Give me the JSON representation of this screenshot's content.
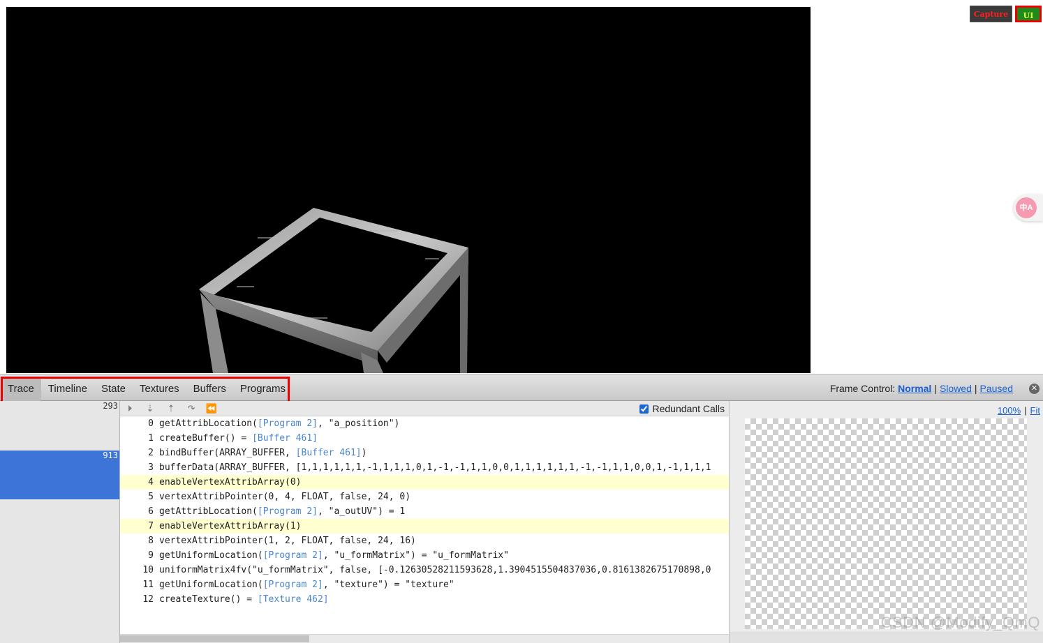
{
  "overlay": {
    "capture_label": "Capture",
    "ui_label": "UI",
    "translate_icon": "translate-icon",
    "translate_glyph": "中A"
  },
  "inspector": {
    "tabs": [
      "Trace",
      "Timeline",
      "State",
      "Textures",
      "Buffers",
      "Programs"
    ],
    "active_tab": "Trace",
    "frame_control": {
      "label": "Frame Control:",
      "options": [
        "Normal",
        "Slowed",
        "Paused"
      ],
      "selected": "Normal"
    },
    "close_icon": "close-icon"
  },
  "frames": [
    {
      "id": "293"
    },
    {
      "id": "913",
      "selected": true
    }
  ],
  "trace": {
    "step_icons": [
      "play-icon",
      "step-over-icon",
      "step-out-icon",
      "step-forward-icon",
      "rewind-icon"
    ],
    "step_glyphs": [
      "⏵",
      "⇣",
      "⇡",
      "↷",
      "⏪"
    ],
    "redundant_calls_label": "Redundant Calls",
    "redundant_calls_checked": true,
    "calls": [
      {
        "n": "0",
        "parts": [
          [
            "getAttribLocation(",
            ""
          ],
          [
            "[Program 2]",
            "ref"
          ],
          [
            ", \"a_position\")",
            ""
          ]
        ]
      },
      {
        "n": "1",
        "parts": [
          [
            "createBuffer() = ",
            ""
          ],
          [
            "[Buffer 461]",
            "ref"
          ]
        ]
      },
      {
        "n": "2",
        "parts": [
          [
            "bindBuffer(ARRAY_BUFFER, ",
            ""
          ],
          [
            "[Buffer 461]",
            "ref"
          ],
          [
            ")",
            ""
          ]
        ]
      },
      {
        "n": "3",
        "parts": [
          [
            "bufferData(ARRAY_BUFFER, [1,1,1,1,1,1,-1,1,1,1,0,1,-1,-1,1,1,0,0,1,1,1,1,1,1,-1,-1,1,1,0,0,1,-1,1,1,1",
            ""
          ]
        ]
      },
      {
        "n": "4",
        "hl": true,
        "parts": [
          [
            "enableVertexAttribArray(0)",
            ""
          ]
        ]
      },
      {
        "n": "5",
        "parts": [
          [
            "vertexAttribPointer(0, 4, FLOAT, false, 24, 0)",
            ""
          ]
        ]
      },
      {
        "n": "6",
        "parts": [
          [
            "getAttribLocation(",
            ""
          ],
          [
            "[Program 2]",
            "ref"
          ],
          [
            ", \"a_outUV\") = 1",
            ""
          ]
        ]
      },
      {
        "n": "7",
        "hl": true,
        "parts": [
          [
            "enableVertexAttribArray(1)",
            ""
          ]
        ]
      },
      {
        "n": "8",
        "parts": [
          [
            "vertexAttribPointer(1, 2, FLOAT, false, 24, 16)",
            ""
          ]
        ]
      },
      {
        "n": "9",
        "parts": [
          [
            "getUniformLocation(",
            ""
          ],
          [
            "[Program 2]",
            "ref"
          ],
          [
            ", \"u_formMatrix\") = \"u_formMatrix\"",
            ""
          ]
        ]
      },
      {
        "n": "10",
        "parts": [
          [
            "uniformMatrix4fv(\"u_formMatrix\", false, [-0.12630528211593628,1.3904515504837036,0.8161382675170898,0",
            ""
          ]
        ]
      },
      {
        "n": "11",
        "parts": [
          [
            "getUniformLocation(",
            ""
          ],
          [
            "[Program 2]",
            "ref"
          ],
          [
            ", \"texture\") = \"texture\"",
            ""
          ]
        ]
      },
      {
        "n": "12",
        "parts": [
          [
            "createTexture() = ",
            ""
          ],
          [
            "[Texture 462]",
            "ref"
          ]
        ]
      }
    ]
  },
  "preview": {
    "zoom_100": "100%",
    "zoom_fit": "Fit"
  },
  "watermark": "CSDN @Modify_QmQ",
  "colors": {
    "highlight_red": "#e00000",
    "selected_blue": "#3c74d7",
    "link_blue": "#1a5fd0",
    "ref_blue": "#4a86cf",
    "row_highlight": "#ffffd0"
  }
}
